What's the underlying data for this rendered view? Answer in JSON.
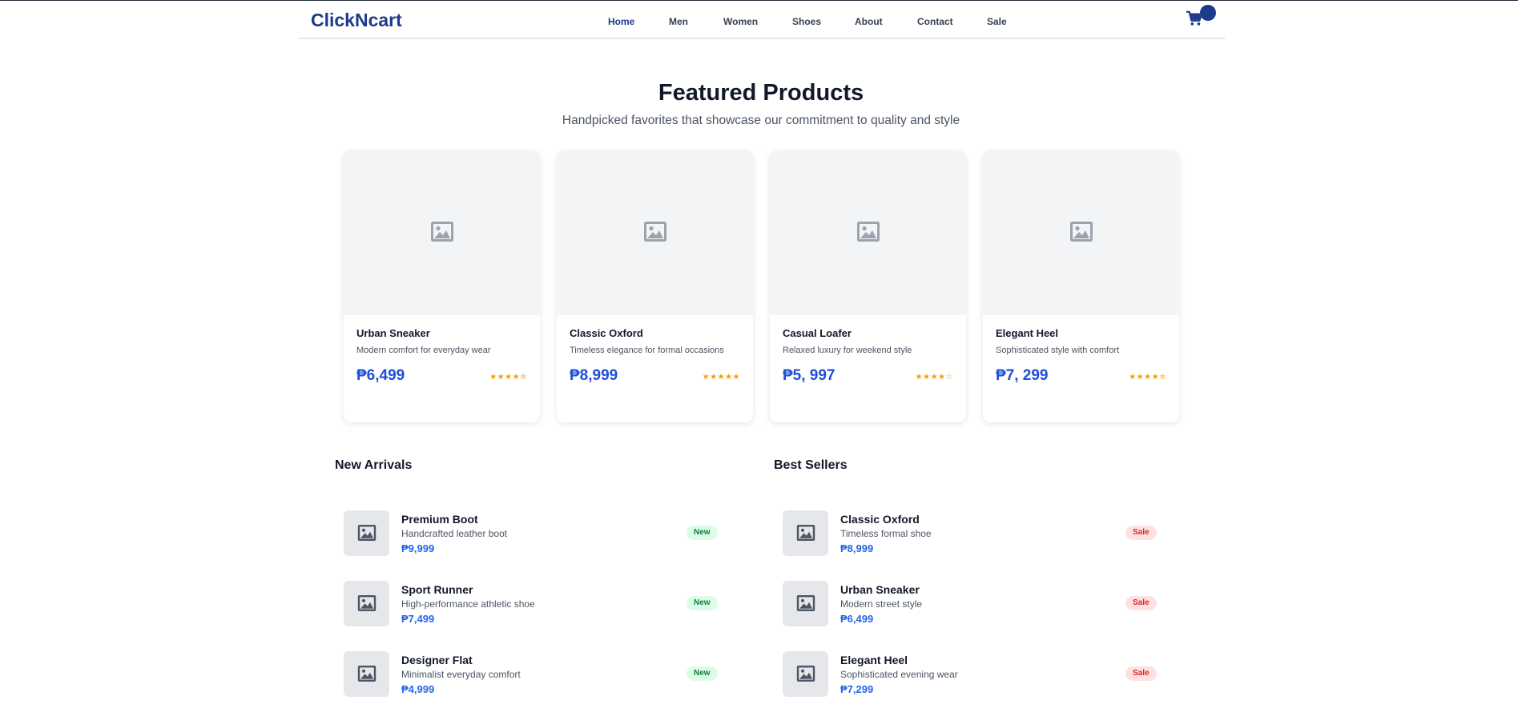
{
  "header": {
    "logo": "ClickNcart",
    "nav": [
      "Home",
      "Men",
      "Women",
      "Shoes",
      "About",
      "Contact",
      "Sale"
    ],
    "active_nav": "Home",
    "accent_color": "#1e3a8a"
  },
  "featured": {
    "title": "Featured Products",
    "subtitle": "Handpicked favorites that showcase our commitment to quality and style",
    "products": [
      {
        "name": "Urban Sneaker",
        "desc": "Modern comfort for everyday wear",
        "price": "₱6,499",
        "stars": "★★★★✮",
        "rating": 4.5
      },
      {
        "name": "Classic Oxford",
        "desc": "Timeless elegance for formal occasions",
        "price": "₱8,999",
        "stars": "★★★★★",
        "rating": 5
      },
      {
        "name": "Casual Loafer",
        "desc": "Relaxed luxury for weekend style",
        "price": "₱5, 997",
        "stars": "★★★★☆",
        "rating": 4
      },
      {
        "name": "Elegant Heel",
        "desc": "Sophisticated style with comfort",
        "price": "₱7, 299",
        "stars": "★★★★✮",
        "rating": 4.5
      }
    ]
  },
  "new_arrivals": {
    "title": "New Arrivals",
    "items": [
      {
        "name": "Premium Boot",
        "desc": "Handcrafted leather boot",
        "price": "₱9,999",
        "badge": "New"
      },
      {
        "name": "Sport Runner",
        "desc": "High-performance athletic shoe",
        "price": "₱7,499",
        "badge": "New"
      },
      {
        "name": "Designer Flat",
        "desc": "Minimalist everyday comfort",
        "price": "₱4,999",
        "badge": "New"
      }
    ]
  },
  "best_sellers": {
    "title": "Best Sellers",
    "items": [
      {
        "name": "Classic Oxford",
        "desc": "Timeless formal shoe",
        "price": "₱8,999",
        "badge": "Sale"
      },
      {
        "name": "Urban Sneaker",
        "desc": "Modern street style",
        "price": "₱6,499",
        "badge": "Sale"
      },
      {
        "name": "Elegant Heel",
        "desc": "Sophisticated evening wear",
        "price": "₱7,299",
        "badge": "Sale"
      }
    ]
  }
}
